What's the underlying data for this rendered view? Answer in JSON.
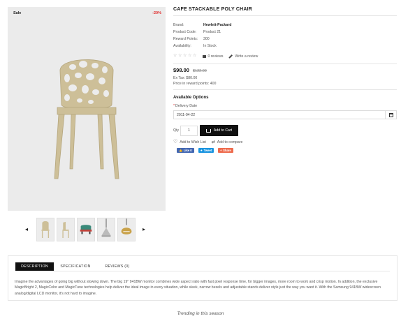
{
  "gallery": {
    "sale_label": "Sale",
    "discount_label": "-20%",
    "prev_arrow": "◂",
    "next_arrow": "▸",
    "thumbnails": [
      "chair-beige-front",
      "chair-beige-side",
      "chair-green-red",
      "pendant-lamp",
      "pendant-lamp-gold"
    ]
  },
  "product": {
    "title": "CAFE STACKABLE POLY CHAIR",
    "meta": [
      {
        "label": "Brand:",
        "value": "Hewlett-Packard"
      },
      {
        "label": "Product Code:",
        "value": "Product 21"
      },
      {
        "label": "Reward Points:",
        "value": "300"
      },
      {
        "label": "Availability:",
        "value": "In Stock"
      }
    ],
    "rating_stars": 5,
    "reviews_link": "0 reviews",
    "write_review_link": "Write a review",
    "price_new": "$98.00",
    "price_old": "$122.00",
    "ex_tax": "Ex Tax: $80.00",
    "reward_price": "Price in reward points: 400"
  },
  "options": {
    "title": "Available Options",
    "delivery_label": "Delivery Date",
    "delivery_value": "2011-04-22",
    "qty_label": "Qty",
    "qty_value": "1",
    "add_to_cart": "Add to Cart",
    "wishlist": "Add to Wish List",
    "compare": "Add to compare"
  },
  "share": {
    "like": "Like 0",
    "tweet": "Tweet",
    "share": "Share"
  },
  "tabs": {
    "items": [
      "DESCRIPTION",
      "SPECIFICATION",
      "REVIEWS (0)"
    ],
    "active": 0,
    "description": "Imagine the advantages of going big without slowing down. The big 19\" 941BW monitor combines wide aspect ratio with fast pixel response time, for bigger images, more room to work and crisp motion. In addition, the exclusive MagicBright 2, MagicColor and MagicTune technologies help deliver the ideal image in every situation, while sleek, narrow bezels and adjustable stands deliver style just the way you want it. With the Samsung 941BW widescreen analog/digital LCD monitor, it's not hard to imagine."
  },
  "footer": {
    "trending": "Trending in this season"
  },
  "colors": {
    "accent": "#111111",
    "sale_red": "#e02a2a",
    "chair_beige": "#cdbf98"
  }
}
